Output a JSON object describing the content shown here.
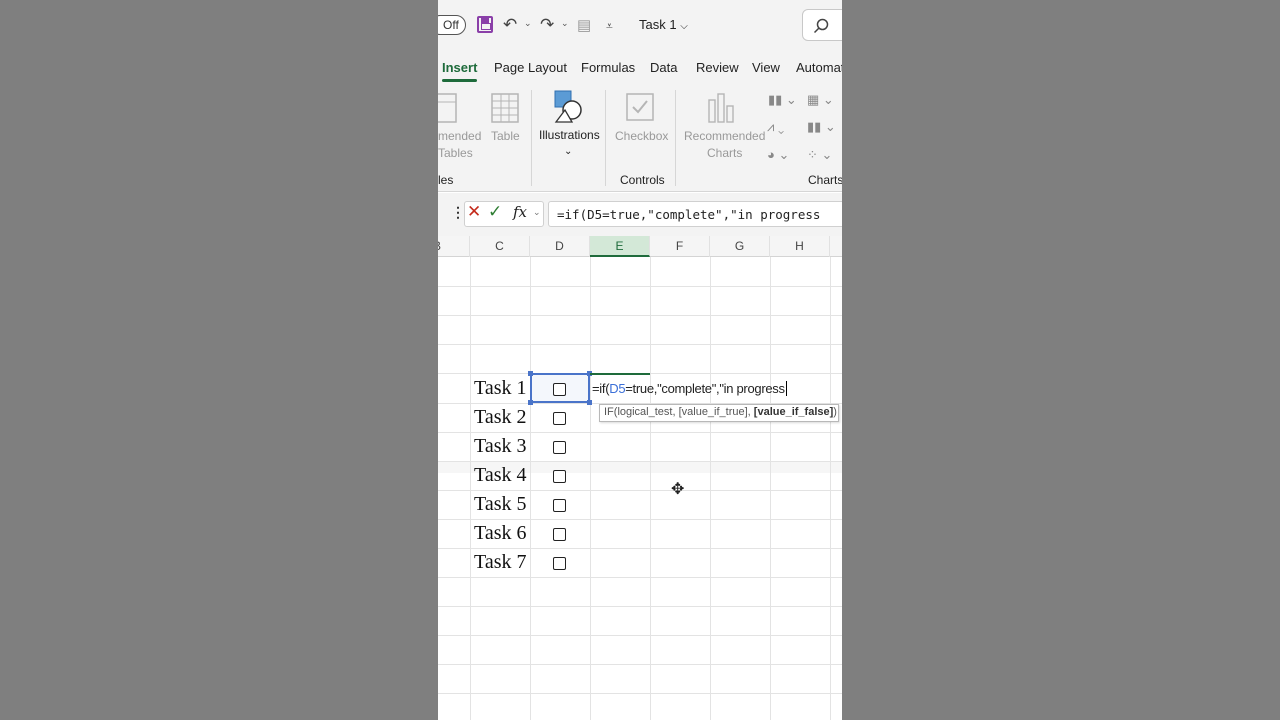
{
  "titlebar": {
    "autosave_label": "Off",
    "doc_title": "Task 1"
  },
  "tabs": [
    "Insert",
    "Page Layout",
    "Formulas",
    "Data",
    "Review",
    "View",
    "Automat"
  ],
  "ribbon": {
    "recommended_pivot": [
      "mended",
      "Tables"
    ],
    "table_label": "Table",
    "illustrations_label": "Illustrations",
    "checkbox_label": "Checkbox",
    "recommended_charts": [
      "Recommended",
      "Charts"
    ],
    "groups": {
      "tables": "les",
      "controls": "Controls",
      "charts": "Charts"
    }
  },
  "formula_bar": {
    "fx_label": "fx",
    "formula_text": "=if(D5=true,\"complete\",\"in progress"
  },
  "columns": [
    "B",
    "C",
    "D",
    "E",
    "F",
    "G",
    "H"
  ],
  "selected_column": "E",
  "tasks": [
    "Task 1",
    "Task 2",
    "Task 3",
    "Task 4",
    "Task 5",
    "Task 6",
    "Task 7"
  ],
  "cell_edit": {
    "prefix": "=if(",
    "ref": "D5",
    "suffix": "=true,\"complete\",\"in progress"
  },
  "tooltip": {
    "args": "IF(logical_test, [value_if_true], ",
    "current": "[value_if_false]",
    "close": ")"
  }
}
